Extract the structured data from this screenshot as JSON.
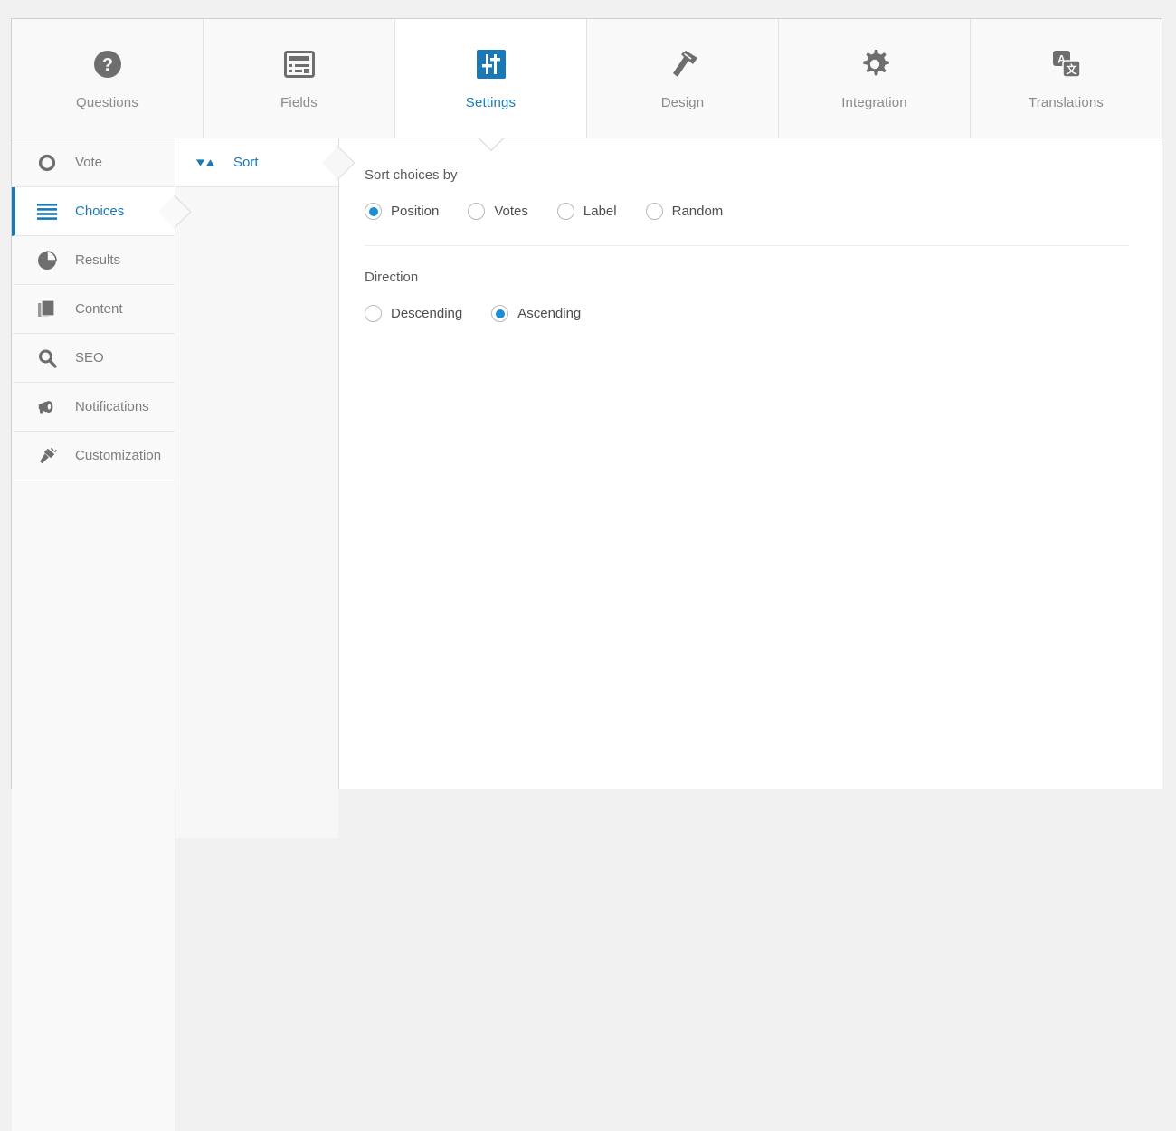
{
  "tabs": [
    {
      "label": "Questions",
      "icon": "question-mark-circle-icon",
      "active": false
    },
    {
      "label": "Fields",
      "icon": "form-fields-icon",
      "active": false
    },
    {
      "label": "Settings",
      "icon": "sliders-settings-icon",
      "active": true
    },
    {
      "label": "Design",
      "icon": "hammer-icon",
      "active": false
    },
    {
      "label": "Integration",
      "icon": "gear-icon",
      "active": false
    },
    {
      "label": "Translations",
      "icon": "translate-icon",
      "active": false
    }
  ],
  "sidebar": {
    "items": [
      {
        "label": "Vote",
        "icon": "circle-outline-icon",
        "active": false
      },
      {
        "label": "Choices",
        "icon": "list-lines-icon",
        "active": true
      },
      {
        "label": "Results",
        "icon": "pie-chart-icon",
        "active": false
      },
      {
        "label": "Content",
        "icon": "stacked-pages-icon",
        "active": false
      },
      {
        "label": "SEO",
        "icon": "magnifier-icon",
        "active": false
      },
      {
        "label": "Notifications",
        "icon": "megaphone-icon",
        "active": false
      },
      {
        "label": "Customization",
        "icon": "plug-icon",
        "active": false
      }
    ]
  },
  "subnav": {
    "items": [
      {
        "label": "Sort",
        "icon": "sort-arrows-icon",
        "active": true
      }
    ]
  },
  "main": {
    "sort_by": {
      "label": "Sort choices by",
      "options": [
        {
          "label": "Position",
          "selected": true
        },
        {
          "label": "Votes",
          "selected": false
        },
        {
          "label": "Label",
          "selected": false
        },
        {
          "label": "Random",
          "selected": false
        }
      ]
    },
    "direction": {
      "label": "Direction",
      "options": [
        {
          "label": "Descending",
          "selected": false
        },
        {
          "label": "Ascending",
          "selected": true
        }
      ]
    }
  },
  "colors": {
    "accent": "#1a79b5",
    "radio_selected": "#1a8fd1",
    "icon_gray": "#6e6e6e",
    "text_gray": "#7d7d7d",
    "panel_bg": "#ffffff",
    "page_bg": "#f1f1f1"
  }
}
